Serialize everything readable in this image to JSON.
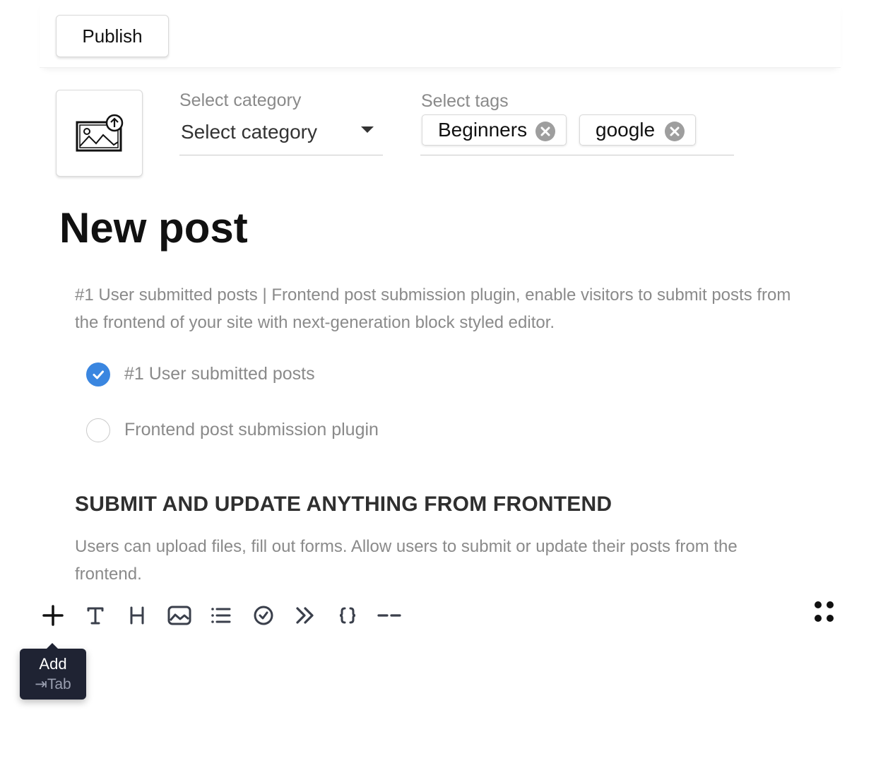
{
  "header": {
    "publish_label": "Publish"
  },
  "meta": {
    "category_label": "Select category",
    "category_value": "Select category",
    "tags_label": "Select tags",
    "tags": [
      "Beginners",
      "google"
    ]
  },
  "post": {
    "title": "New post",
    "paragraph1": "#1 User submitted posts | Frontend post submission plugin, enable visitors to submit posts from the frontend of your site with next-generation block styled editor.",
    "checklist": [
      {
        "label": "#1 User submitted posts",
        "checked": true
      },
      {
        "label": "Frontend post submission plugin",
        "checked": false
      }
    ],
    "heading": "SUBMIT AND UPDATE ANYTHING FROM FRONTEND",
    "paragraph2": "Users can upload files, fill out forms. Allow users to submit or update their posts from the frontend."
  },
  "toolbar": {
    "tools": [
      "add-icon",
      "text-icon",
      "heading-icon",
      "image-icon",
      "list-icon",
      "checklist-icon",
      "quote-icon",
      "code-icon",
      "delimiter-icon"
    ],
    "tooltip_title": "Add",
    "tooltip_shortcut": "⇥Tab"
  },
  "colors": {
    "accent": "#3a86e0",
    "tooltip_bg": "#1f2333",
    "icon": "#3a3f4b"
  }
}
